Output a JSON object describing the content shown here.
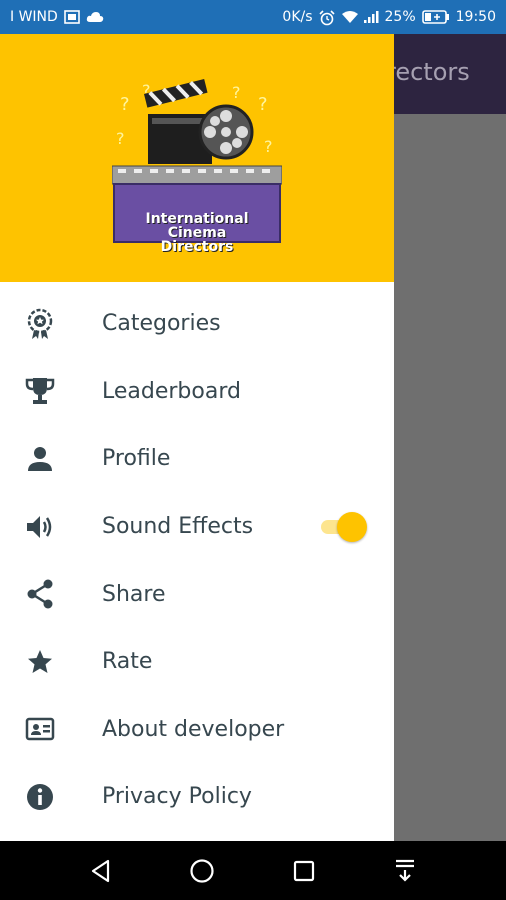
{
  "status_bar": {
    "carrier": "I WIND",
    "network_speed": "0K/s",
    "battery": "25%",
    "time": "19:50",
    "icons": [
      "sim-icon",
      "cloud-icon",
      "alarm-icon",
      "wifi-icon",
      "signal-icon",
      "battery-icon"
    ]
  },
  "background_app": {
    "title_fragment": "rectors"
  },
  "drawer": {
    "logo": {
      "line1": "International",
      "line2": "Cinema",
      "line3": "Directors"
    },
    "items": [
      {
        "label": "Categories",
        "icon": "badge-icon"
      },
      {
        "label": "Leaderboard",
        "icon": "trophy-icon"
      },
      {
        "label": "Profile",
        "icon": "person-icon"
      },
      {
        "label": "Sound Effects",
        "icon": "volume-icon",
        "toggle_on": true
      },
      {
        "label": "Share",
        "icon": "share-icon"
      },
      {
        "label": "Rate",
        "icon": "star-icon"
      },
      {
        "label": "About developer",
        "icon": "id-card-icon"
      },
      {
        "label": "Privacy Policy",
        "icon": "info-icon"
      }
    ]
  },
  "nav_bar": {
    "buttons": [
      "back-icon",
      "home-icon",
      "recents-icon",
      "notification-drawer-icon"
    ]
  },
  "colors": {
    "accent": "#fec300",
    "status_bar": "#1f6fb6",
    "text": "#37474f"
  }
}
